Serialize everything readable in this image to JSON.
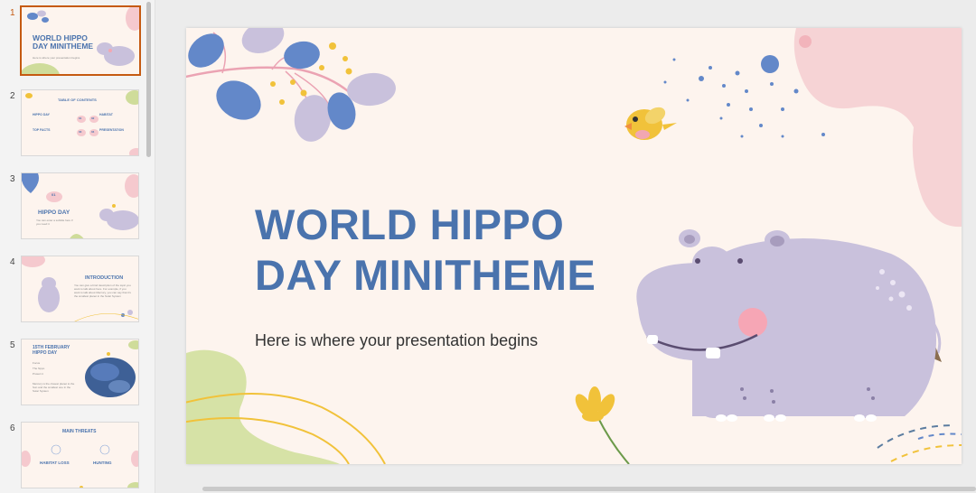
{
  "thumbnails": [
    {
      "number": "1",
      "title": "WORLD HIPPO DAY MINITHEME",
      "text": "Here is where your presentation begins"
    },
    {
      "number": "2",
      "title": "TABLE OF CONTENTS",
      "items": [
        {
          "label": "HIPPO DAY",
          "num": "01"
        },
        {
          "label": "HABITAT",
          "num": "02"
        },
        {
          "label": "TOP FACTS",
          "num": "03"
        },
        {
          "label": "PRESENTATION",
          "num": "04"
        }
      ]
    },
    {
      "number": "3",
      "title": "HIPPO DAY",
      "section": "01",
      "text": "You can enter a subtitle here if you need it"
    },
    {
      "number": "4",
      "title": "INTRODUCTION",
      "text": "You can give a brief description of the topic you want to talk about here. For example, if you want to talk about Mercury, you can say that it's the smallest planet in the Solar System"
    },
    {
      "number": "5",
      "title": "15TH FEBRUARY HIPPO DAY",
      "bullets": [
        "Focus",
        "The hippo",
        "Protect it"
      ],
      "text": "Mercury is the closest planet to the Sun and the smallest one in the Solar System"
    },
    {
      "number": "6",
      "title": "MAIN THREATS",
      "items": [
        {
          "label": "HABITAT LOSS"
        },
        {
          "label": "HUNTING"
        }
      ]
    }
  ],
  "slide": {
    "title_line1": "WORLD HIPPO",
    "title_line2": "DAY MINITHEME",
    "subtitle": "Here is where your presentation begins"
  },
  "colors": {
    "accent_active": "#c55a11",
    "title_blue": "#4a73ad",
    "hippo": "#c9c1dc",
    "slide_bg": "#fdf4ee",
    "leaf_blue": "#6388c9",
    "pink": "#f5c9ce",
    "green": "#cfdc9a",
    "yellow": "#f1c23a"
  }
}
